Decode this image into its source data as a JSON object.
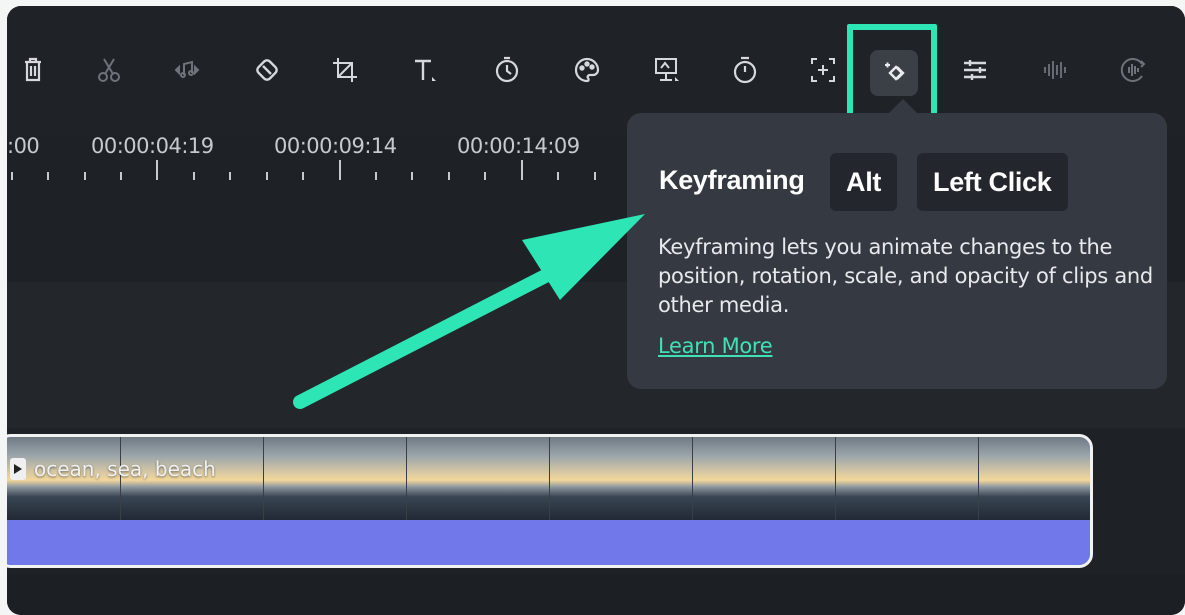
{
  "toolbar": {
    "tools": [
      {
        "icon": "trash-icon"
      },
      {
        "icon": "scissors-icon"
      },
      {
        "icon": "audio-split-icon"
      },
      {
        "icon": "tag-icon"
      },
      {
        "icon": "crop-icon"
      },
      {
        "icon": "text-icon"
      },
      {
        "icon": "speed-icon"
      },
      {
        "icon": "color-palette-icon"
      },
      {
        "icon": "freeze-frame-icon"
      },
      {
        "icon": "timer-icon"
      },
      {
        "icon": "auto-reframe-icon"
      },
      {
        "icon": "keyframe-icon"
      },
      {
        "icon": "adjust-sliders-icon"
      },
      {
        "icon": "audio-waveform-icon"
      },
      {
        "icon": "audio-stretch-icon"
      }
    ],
    "highlight_color": "#2ee6b5"
  },
  "timeline": {
    "timecodes": [
      ":00",
      "00:00:04:19",
      "00:00:09:14",
      "00:00:14:09"
    ]
  },
  "clip": {
    "label": "ocean, sea, beach",
    "color": "#6b72e8"
  },
  "tooltip": {
    "title": "Keyframing",
    "shortcut_key": "Alt",
    "shortcut_action": "Left Click",
    "description": "Keyframing lets you animate changes to the position, rotation, scale, and opacity of clips and other media.",
    "link": "Learn More",
    "link_color": "#3ee2b3"
  },
  "annotation": {
    "arrow_color": "#2ee6b5"
  }
}
